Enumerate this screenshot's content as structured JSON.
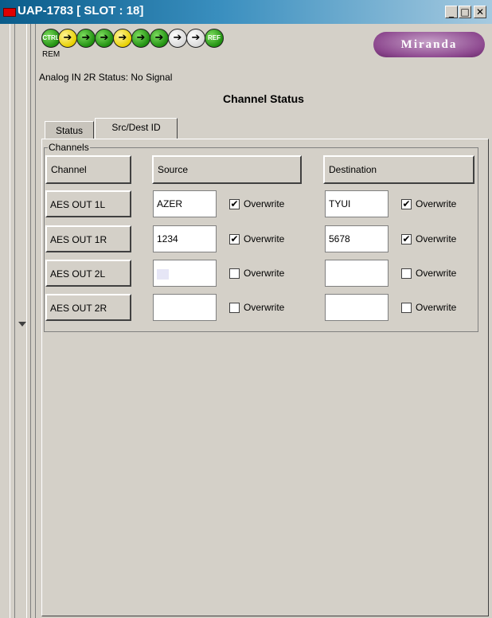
{
  "window": {
    "title": "UAP-1783 [ SLOT : 18]"
  },
  "window_controls": {
    "minimize": "_",
    "maximize": "□",
    "close": "✕"
  },
  "icons": [
    {
      "name": "ctrl-icon",
      "label": "CTRL",
      "color": "green"
    },
    {
      "name": "arrow-icon-1",
      "label": "➔",
      "color": "yellow"
    },
    {
      "name": "arrow-icon-2",
      "label": "➔",
      "color": "green"
    },
    {
      "name": "arrow-icon-3",
      "label": "➔",
      "color": "green"
    },
    {
      "name": "arrow-icon-4",
      "label": "➔",
      "color": "yellow"
    },
    {
      "name": "arrow-icon-5",
      "label": "➔",
      "color": "green"
    },
    {
      "name": "arrow-icon-6",
      "label": "➔",
      "color": "green"
    },
    {
      "name": "arrow-icon-7",
      "label": "➔",
      "color": "white"
    },
    {
      "name": "arrow-icon-8",
      "label": "➔",
      "color": "white"
    },
    {
      "name": "ref-icon",
      "label": "REF",
      "color": "green"
    }
  ],
  "rem_label": "REM",
  "logo": {
    "text": "Miranda"
  },
  "status_line": "Analog IN 2R Status: No Signal",
  "panel_title": "Channel Status",
  "tabs": [
    {
      "label": "Status",
      "active": false
    },
    {
      "label": "Src/Dest ID",
      "active": true
    }
  ],
  "group": {
    "legend": "Channels",
    "headers": {
      "channel": "Channel",
      "source": "Source",
      "destination": "Destination"
    },
    "rows": [
      {
        "channel": "AES OUT 1L",
        "source": "AZER",
        "source_overwrite": true,
        "destination": "TYUI",
        "destination_overwrite": true
      },
      {
        "channel": "AES OUT 1R",
        "source": "1234",
        "source_overwrite": true,
        "destination": "5678",
        "destination_overwrite": true
      },
      {
        "channel": "AES OUT 2L",
        "source": "",
        "source_overwrite": false,
        "destination": "",
        "destination_overwrite": false
      },
      {
        "channel": "AES OUT 2R",
        "source": "",
        "source_overwrite": false,
        "destination": "",
        "destination_overwrite": false
      }
    ],
    "overwrite_label": "Overwrite"
  },
  "colors": {
    "title_bar": "#0a5c8a",
    "panel_bg": "#d4d0c8",
    "led_red": "#e00000",
    "logo_purple": "#8e4a90"
  }
}
